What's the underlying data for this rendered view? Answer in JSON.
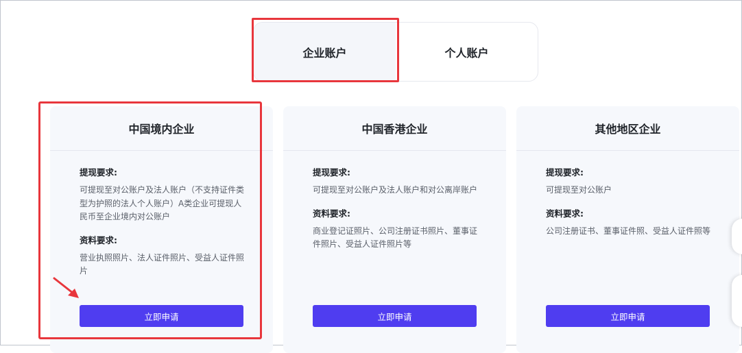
{
  "tabs": [
    {
      "label": "企业账户",
      "active": true
    },
    {
      "label": "个人账户",
      "active": false
    }
  ],
  "cards": [
    {
      "title": "中国境内企业",
      "withdraw_title": "提现要求:",
      "withdraw_text": "可提现至对公账户及法人账户（不支持证件类型为护照的法人个人账户）A类企业可提现人民币至企业境内对公账户",
      "docs_title": "资料要求:",
      "docs_text": "营业执照照片、法人证件照片、受益人证件照片",
      "button": "立即申请"
    },
    {
      "title": "中国香港企业",
      "withdraw_title": "提现要求:",
      "withdraw_text": "可提现至对公账户及法人账户和对公离岸账户",
      "docs_title": "资料要求:",
      "docs_text": "商业登记证照片、公司注册证书照片、董事证件照片、受益人证件照片等",
      "button": "立即申请"
    },
    {
      "title": "其他地区企业",
      "withdraw_title": "提现要求:",
      "withdraw_text": "可提现至对公账户",
      "docs_title": "资料要求:",
      "docs_text": "公司注册证书、董事证件照、受益人证件照等",
      "button": "立即申请"
    }
  ],
  "colors": {
    "accent": "#4f3df0",
    "highlight": "#e8363c",
    "card_bg": "#f6f8fc"
  }
}
